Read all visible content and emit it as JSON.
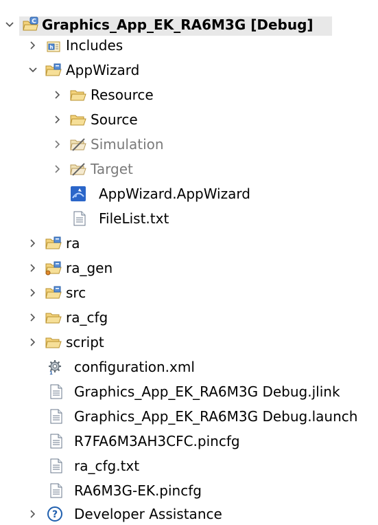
{
  "tree": {
    "project": {
      "label": "Graphics_App_EK_RA6M3G [Debug]"
    },
    "includes": {
      "label": "Includes"
    },
    "appwizard": {
      "label": "AppWizard"
    },
    "resource": {
      "label": "Resource"
    },
    "source": {
      "label": "Source"
    },
    "simulation": {
      "label": "Simulation"
    },
    "target": {
      "label": "Target"
    },
    "appwizard_file": {
      "label": "AppWizard.AppWizard"
    },
    "filelist": {
      "label": "FileList.txt"
    },
    "ra": {
      "label": "ra"
    },
    "ra_gen": {
      "label": "ra_gen"
    },
    "src": {
      "label": "src"
    },
    "ra_cfg": {
      "label": "ra_cfg"
    },
    "script": {
      "label": "script"
    },
    "configuration": {
      "label": "configuration.xml"
    },
    "jlink": {
      "label": "Graphics_App_EK_RA6M3G Debug.jlink"
    },
    "launch": {
      "label": "Graphics_App_EK_RA6M3G Debug.launch"
    },
    "pincfg1": {
      "label": "R7FA6M3AH3CFC.pincfg"
    },
    "ra_cfg_txt": {
      "label": "ra_cfg.txt"
    },
    "pincfg2": {
      "label": "RA6M3G-EK.pincfg"
    },
    "dev_assist": {
      "label": "Developer Assistance"
    }
  },
  "colors": {
    "selection": "#e8e8e8",
    "folder": "#f3d37d",
    "folder_edge": "#b8902d",
    "dimmed_text": "#7a7a7a",
    "chevron": "#555555",
    "help_blue": "#1f5fae"
  },
  "icons": {
    "expanded": "chevron-down-icon",
    "collapsed": "chevron-right-icon",
    "project": "c-project-icon",
    "includes": "includes-icon",
    "source_folder": "source-folder-icon",
    "folder": "folder-icon",
    "excluded_folder": "excluded-folder-icon",
    "appwizard": "appwizard-icon",
    "file": "text-file-icon",
    "config": "gear-file-icon",
    "help": "help-icon"
  }
}
